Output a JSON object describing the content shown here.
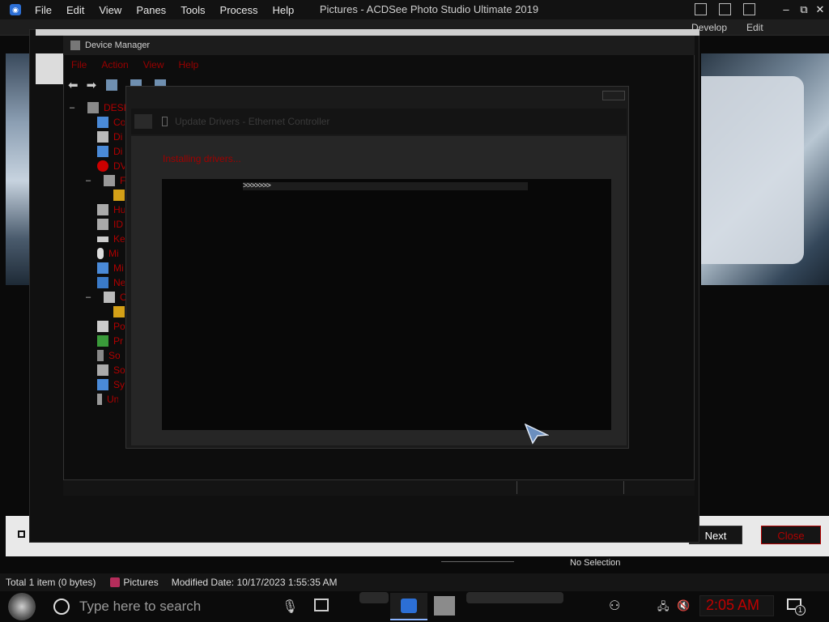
{
  "acdsee": {
    "title": "Pictures - ACDSee Photo Studio Ultimate 2019",
    "menu": [
      "File",
      "Edit",
      "View",
      "Panes",
      "Tools",
      "Process",
      "Help"
    ],
    "modes": {
      "develop": "Develop",
      "edit": "Edit"
    },
    "status": {
      "total": "Total 1 item  (0 bytes)",
      "folder": "Pictures",
      "modified": "Modified Date: 10/17/2023 1:55:35 AM"
    },
    "selection": "No Selection"
  },
  "wizard": {
    "next_label": "Next",
    "close_label": "Close"
  },
  "device_manager": {
    "title": "Device Manager",
    "menu": [
      "File",
      "Action",
      "View",
      "Help"
    ],
    "tree_root": "DESK",
    "tree_items": [
      "Co",
      "Di",
      "Di",
      "DV",
      "Fi",
      "",
      "Hu",
      "ID",
      "Ke",
      "Mi",
      "Mi",
      "Ne",
      "Ot",
      "",
      "Po",
      "Pr",
      "So",
      "So",
      "Sy",
      "Un"
    ]
  },
  "update_drivers": {
    "title": "Update Drivers - Ethernet Controller",
    "status_text": "Installing drivers...",
    "progress_text": ">>>>>>>",
    "progress": 0.17
  },
  "taskbar": {
    "search_placeholder": "Type here to search",
    "clock": "2:05 AM",
    "notification_count": "1"
  },
  "colors": {
    "accent_red": "#b00000",
    "acdsee_blue": "#2c6fd6"
  }
}
